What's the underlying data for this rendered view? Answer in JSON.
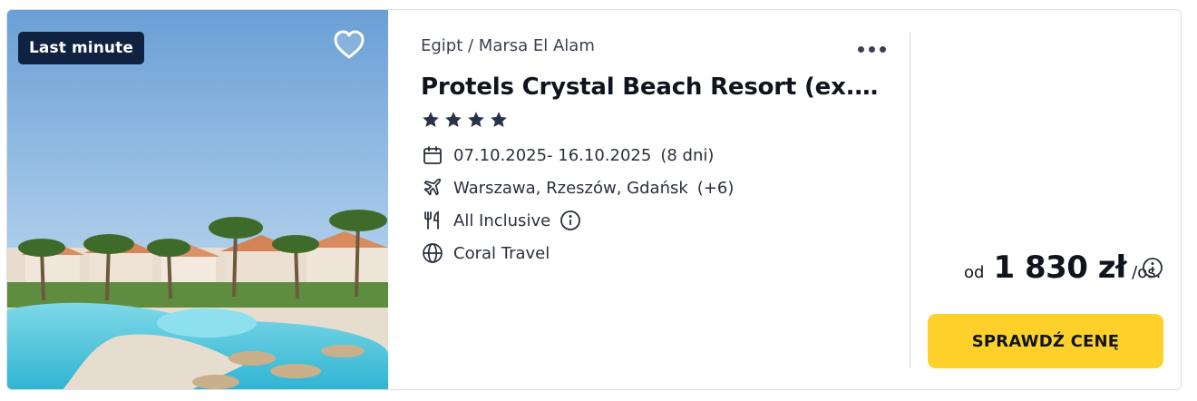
{
  "offer": {
    "badge": "Last minute",
    "location": "Egipt / Marsa El Alam",
    "title": "Protels Crystal Beach Resort (ex. Blue Reef Red Sea Resort)",
    "stars": 4,
    "dates": "07.10.2025- 16.10.2025",
    "duration": "(8 dni)",
    "departures": "Warszawa, Rzeszów, Gdańsk",
    "departures_more": "(+6)",
    "board": "All Inclusive",
    "operator": "Coral Travel"
  },
  "price": {
    "prefix": "od",
    "amount": "1 830 zł",
    "suffix": "/os."
  },
  "cta": {
    "label": "SPRAWDŹ CENĘ"
  },
  "colors": {
    "badge_bg": "#0f2242",
    "cta_bg": "#fdd12a",
    "text": "#10141d",
    "star": "#2b3447"
  },
  "icons": {
    "favorite": "heart-outline-icon",
    "more": "more-dots-icon",
    "calendar": "calendar-icon",
    "flight": "plane-icon",
    "board": "cutlery-icon",
    "operator": "globe-icon",
    "info": "info-icon"
  }
}
